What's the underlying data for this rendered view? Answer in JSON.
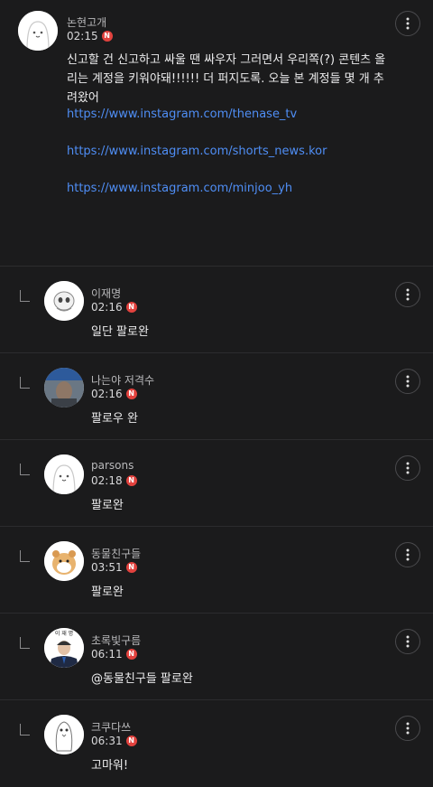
{
  "post": {
    "author": "논현고개",
    "time": "02:15",
    "badge": "N",
    "body": "신고할 건 신고하고 싸울 땐 싸우자 그러면서 우리쪽(?) 콘텐츠 올리는 계정을 키워야돼!!!!!! 더 퍼지도록. 오늘 본 계정들 몇 개 추려왔어",
    "links": [
      "https://www.instagram.com/thenase_tv",
      "https://www.instagram.com/shorts_news.kor",
      "https://www.instagram.com/minjoo_yh"
    ]
  },
  "replies": [
    {
      "author": "이재명",
      "time": "02:16",
      "badge": "N",
      "text": "일단 팔로완",
      "avatar": "ghost-avatar"
    },
    {
      "author": "나는야 저격수",
      "time": "02:16",
      "badge": "N",
      "text": "팔로우 완",
      "avatar": "photo-avatar"
    },
    {
      "author": "parsons",
      "time": "02:18",
      "badge": "N",
      "text": "팔로완",
      "avatar": "default-avatar"
    },
    {
      "author": "동물친구들",
      "time": "03:51",
      "badge": "N",
      "text": "팔로완",
      "avatar": "hamster-avatar"
    },
    {
      "author": "초록빛구름",
      "time": "06:11",
      "badge": "N",
      "text": "@동물친구들 팔로완",
      "avatar": "portrait-avatar",
      "avatar_caption": "이 재 명"
    },
    {
      "author": "크쿠다쓰",
      "time": "06:31",
      "badge": "N",
      "text": "고마워!",
      "avatar": "penguin-avatar"
    }
  ],
  "colors": {
    "background": "#1b1b1c",
    "link": "#4f8ef5",
    "badge": "#e2423e",
    "divider": "#2c2c2e"
  }
}
